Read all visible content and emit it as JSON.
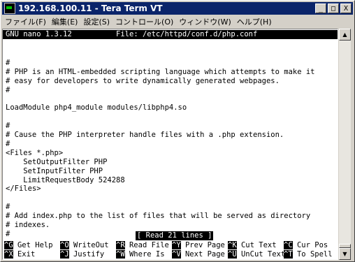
{
  "window": {
    "title": "192.168.100.11 - Tera Term VT",
    "buttons": {
      "minimize": "_",
      "maximize": "□",
      "close": "X"
    }
  },
  "menu": [
    "ファイル(F)",
    "編集(E)",
    "設定(S)",
    "コントロール(O)",
    "ウィンドウ(W)",
    "ヘルプ(H)"
  ],
  "nano": {
    "header": "GNU nano 1.3.12          File: /etc/httpd/conf.d/php.conf",
    "lines": [
      "",
      "",
      "#",
      "# PHP is an HTML-embedded scripting language which attempts to make it",
      "# easy for developers to write dynamically generated webpages.",
      "#",
      "",
      "LoadModule php4_module modules/libphp4.so",
      "",
      "#",
      "# Cause the PHP interpreter handle files with a .php extension.",
      "#",
      "<Files *.php>",
      "    SetOutputFilter PHP",
      "    SetInputFilter PHP",
      "    LimitRequestBody 524288",
      "</Files>",
      "",
      "#",
      "# Add index.php to the list of files that will be served as directory",
      "# indexes.",
      "#"
    ],
    "status": "[ Read 21 lines ]",
    "shortcuts_row1": [
      {
        "key": "^G",
        "label": "Get Help"
      },
      {
        "key": "^O",
        "label": "WriteOut"
      },
      {
        "key": "^R",
        "label": "Read File"
      },
      {
        "key": "^Y",
        "label": "Prev Page"
      },
      {
        "key": "^K",
        "label": "Cut Text"
      },
      {
        "key": "^C",
        "label": "Cur Pos"
      }
    ],
    "shortcuts_row2": [
      {
        "key": "^X",
        "label": "Exit"
      },
      {
        "key": "^J",
        "label": "Justify"
      },
      {
        "key": "^W",
        "label": "Where Is"
      },
      {
        "key": "^V",
        "label": "Next Page"
      },
      {
        "key": "^U",
        "label": "UnCut Text"
      },
      {
        "key": "^T",
        "label": "To Spell"
      }
    ]
  },
  "scrollbar": {
    "up_arrow": "▲",
    "down_arrow": "▼"
  }
}
